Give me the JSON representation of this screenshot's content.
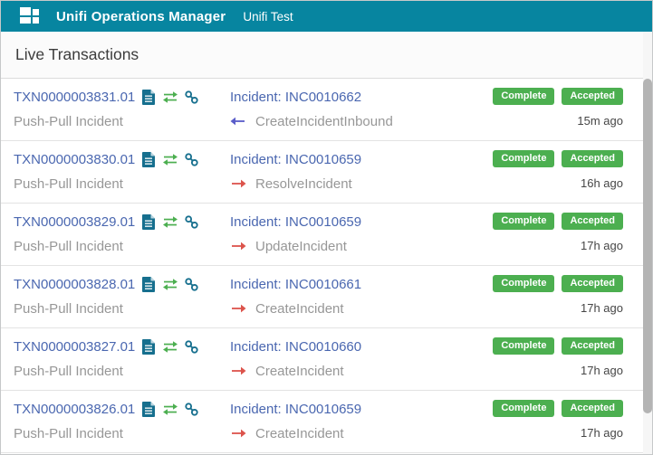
{
  "header": {
    "app_title": "Unifi Operations Manager",
    "workspace": "Unifi Test"
  },
  "section": {
    "title": "Live Transactions"
  },
  "colors": {
    "header_bg": "#0785A0",
    "link_blue": "#4A67B0",
    "badge_green": "#4CAF50",
    "icon_teal": "#166F8E",
    "inbound_arrow": "#5A5DC9",
    "outbound_arrow": "#DC544C"
  },
  "icons": {
    "logo": "grid-tiles-icon",
    "row_icons": [
      "document-icon",
      "transfer-arrows-icon",
      "link-chain-icon"
    ]
  },
  "rows": [
    {
      "txn_id": "TXN0000003831.01",
      "process": "Push-Pull Incident",
      "target": "Incident: INC0010662",
      "direction": "inbound",
      "message": "CreateIncidentInbound",
      "state": "Complete",
      "response": "Accepted",
      "time": "15m ago"
    },
    {
      "txn_id": "TXN0000003830.01",
      "process": "Push-Pull Incident",
      "target": "Incident: INC0010659",
      "direction": "outbound",
      "message": "ResolveIncident",
      "state": "Complete",
      "response": "Accepted",
      "time": "16h ago"
    },
    {
      "txn_id": "TXN0000003829.01",
      "process": "Push-Pull Incident",
      "target": "Incident: INC0010659",
      "direction": "outbound",
      "message": "UpdateIncident",
      "state": "Complete",
      "response": "Accepted",
      "time": "17h ago"
    },
    {
      "txn_id": "TXN0000003828.01",
      "process": "Push-Pull Incident",
      "target": "Incident: INC0010661",
      "direction": "outbound",
      "message": "CreateIncident",
      "state": "Complete",
      "response": "Accepted",
      "time": "17h ago"
    },
    {
      "txn_id": "TXN0000003827.01",
      "process": "Push-Pull Incident",
      "target": "Incident: INC0010660",
      "direction": "outbound",
      "message": "CreateIncident",
      "state": "Complete",
      "response": "Accepted",
      "time": "17h ago"
    },
    {
      "txn_id": "TXN0000003826.01",
      "process": "Push-Pull Incident",
      "target": "Incident: INC0010659",
      "direction": "outbound",
      "message": "CreateIncident",
      "state": "Complete",
      "response": "Accepted",
      "time": "17h ago"
    }
  ]
}
